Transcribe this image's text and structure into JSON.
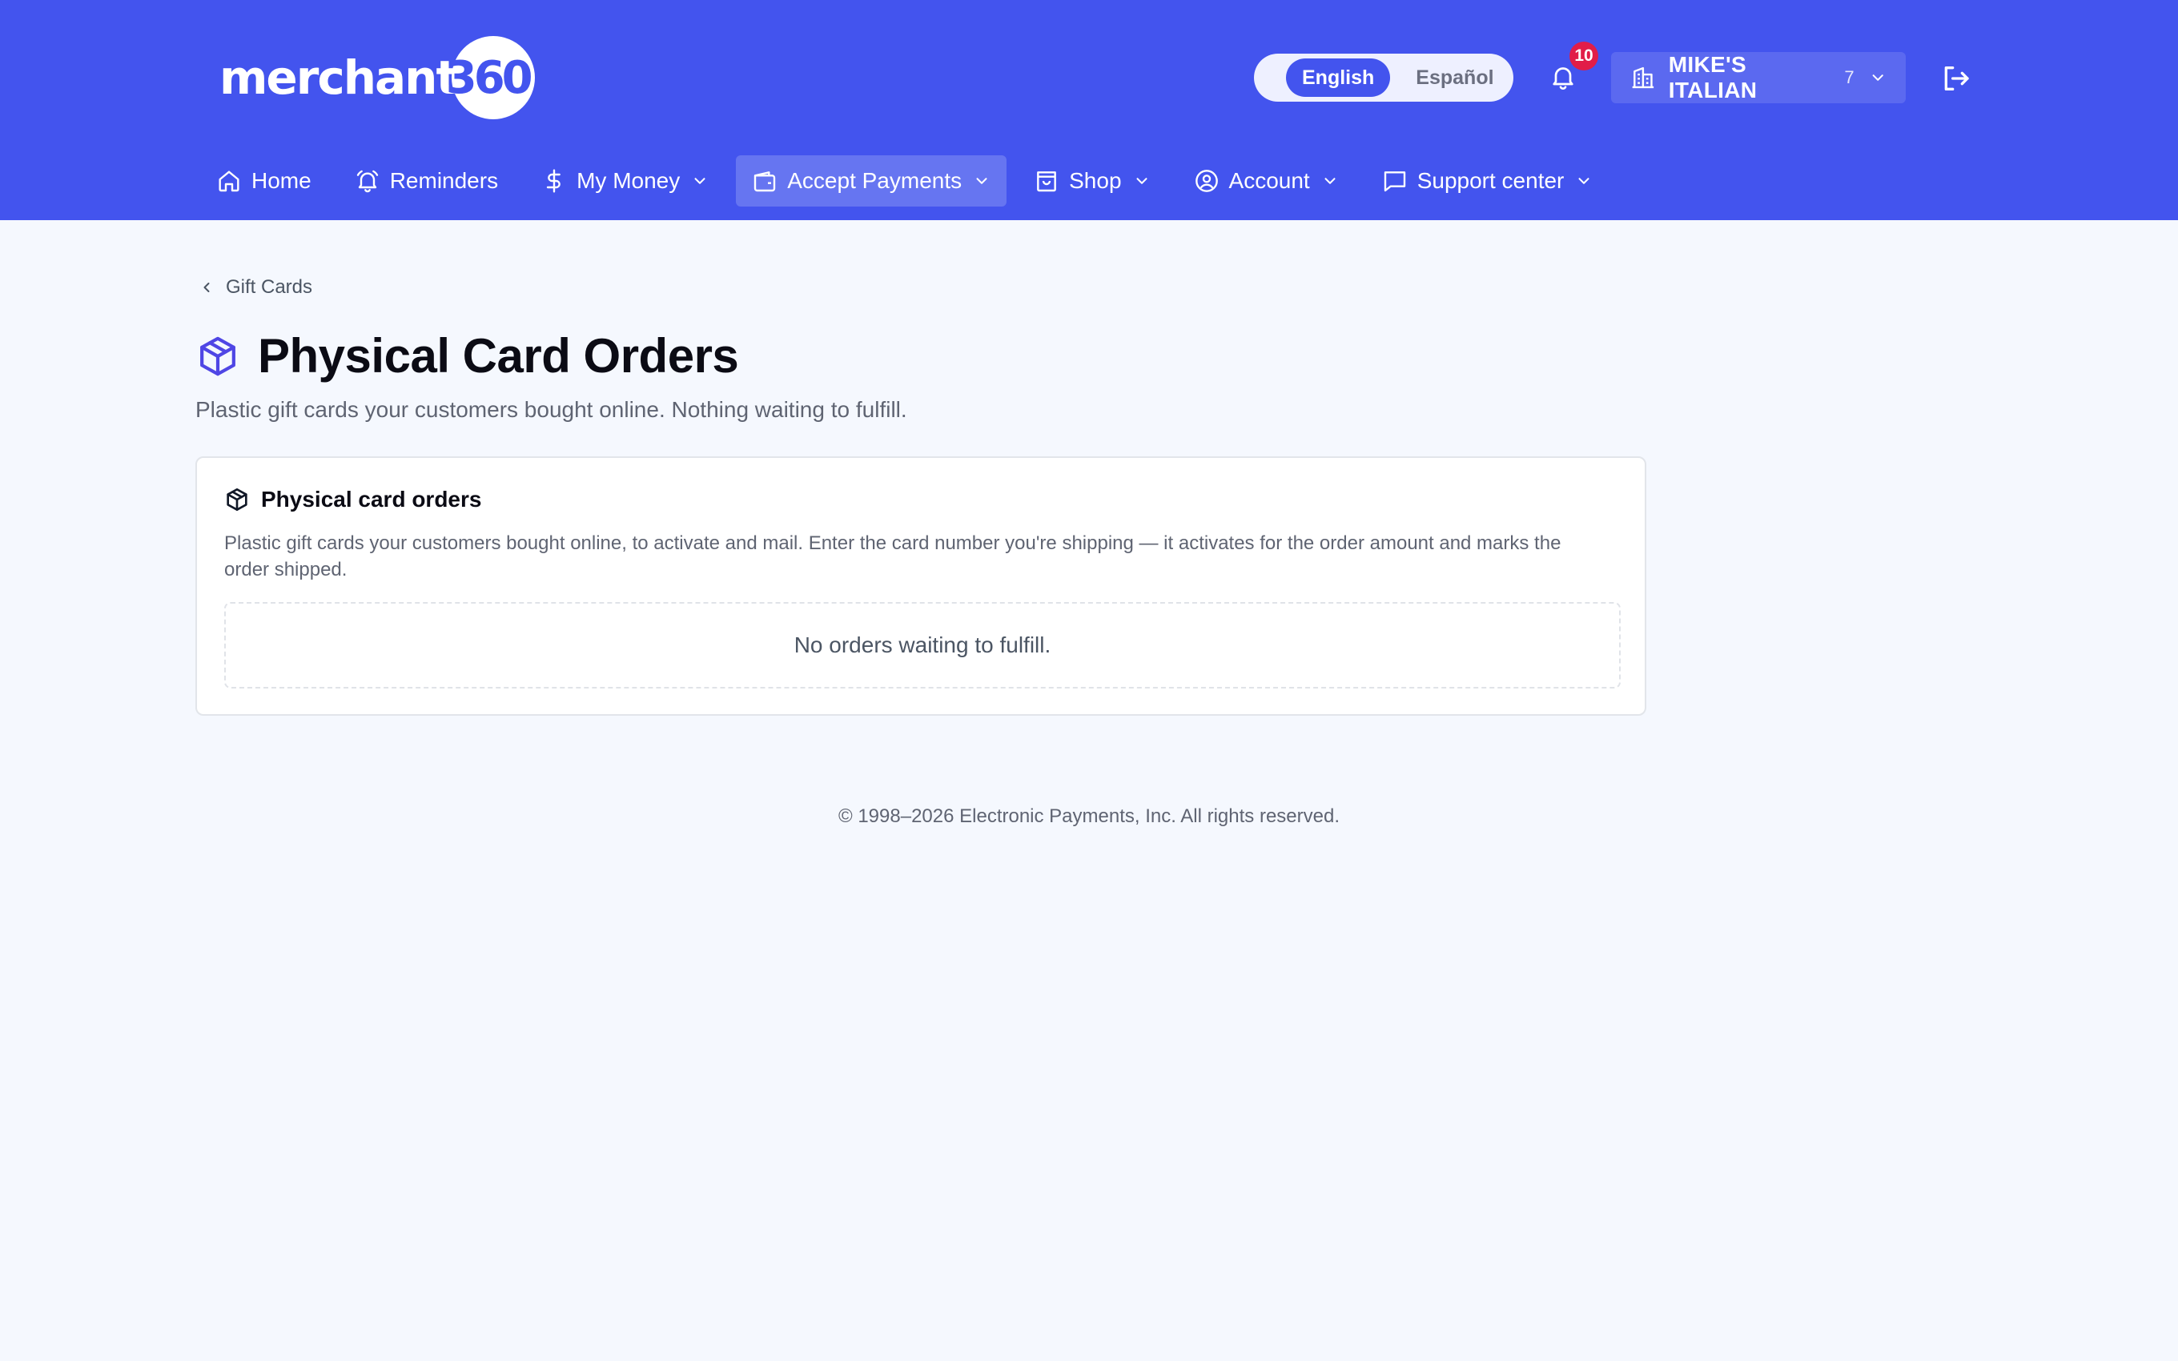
{
  "header": {
    "logo": {
      "text": "merchant",
      "number": "360"
    },
    "language": {
      "options": [
        "English",
        "Español"
      ],
      "selected": "English"
    },
    "notifications": {
      "count": "10"
    },
    "merchant": {
      "name": "MIKE'S ITALIAN",
      "count": "7"
    }
  },
  "nav": {
    "items": [
      {
        "label": "Home",
        "icon": "home-icon",
        "dropdown": false
      },
      {
        "label": "Reminders",
        "icon": "bell-icon",
        "dropdown": false
      },
      {
        "label": "My Money",
        "icon": "dollar-icon",
        "dropdown": true
      },
      {
        "label": "Accept Payments",
        "icon": "wallet-icon",
        "dropdown": true,
        "active": true
      },
      {
        "label": "Shop",
        "icon": "shopping-bag-icon",
        "dropdown": true
      },
      {
        "label": "Account",
        "icon": "user-circle-icon",
        "dropdown": true
      },
      {
        "label": "Support center",
        "icon": "message-icon",
        "dropdown": true
      }
    ]
  },
  "page": {
    "breadcrumb": "Gift Cards",
    "title": "Physical Card Orders",
    "subtitle": "Plastic gift cards your customers bought online. Nothing waiting to fulfill.",
    "card": {
      "title": "Physical card orders",
      "description": "Plastic gift cards your customers bought online, to activate and mail. Enter the card number you're shipping — it activates for the order amount and marks the order shipped.",
      "empty_message": "No orders waiting to fulfill."
    }
  },
  "footer": {
    "copyright": "© 1998–2026 Electronic Payments, Inc. All rights reserved."
  },
  "colors": {
    "brand": "#4354ee",
    "page_background": "#f5f8fe",
    "badge": "#e11d48",
    "title_icon": "#4f46e5"
  }
}
